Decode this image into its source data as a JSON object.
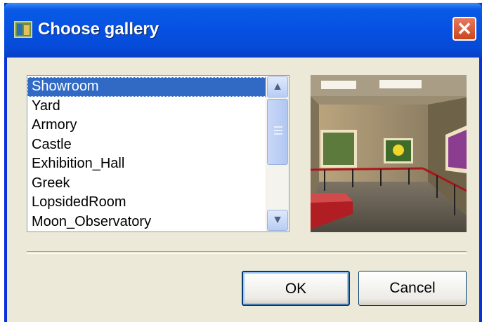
{
  "window": {
    "title": "Choose gallery",
    "title_icon": "gallery-app-icon",
    "close_icon": "close-icon",
    "close_glyph": "✕"
  },
  "gallery_list": {
    "selected_index": 0,
    "items": [
      {
        "label": "Showroom"
      },
      {
        "label": "Yard"
      },
      {
        "label": "Armory"
      },
      {
        "label": "Castle"
      },
      {
        "label": "Exhibition_Hall"
      },
      {
        "label": "Greek"
      },
      {
        "label": "LopsidedRoom"
      },
      {
        "label": "Moon_Observatory"
      }
    ],
    "scroll_up_glyph": "▲",
    "scroll_down_glyph": "▼"
  },
  "preview": {
    "icon": "gallery-preview-image"
  },
  "buttons": {
    "ok": "OK",
    "cancel": "Cancel"
  },
  "colors": {
    "title_bar": "#0651e2",
    "selection": "#316ac5",
    "dialog_bg": "#ece9d8",
    "close_button": "#d6582c"
  }
}
